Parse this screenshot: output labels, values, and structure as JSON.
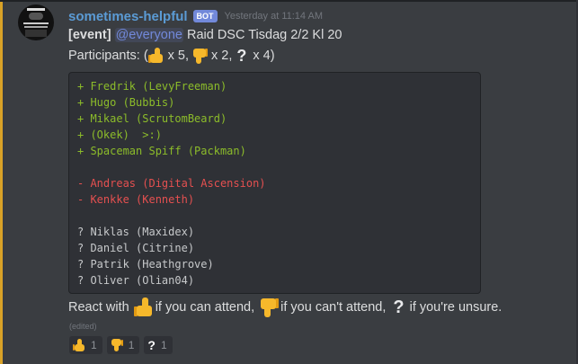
{
  "message": {
    "username": "sometimes-helpful",
    "bot_tag": "BOT",
    "timestamp": "Yesterday at 11:14 AM",
    "event_tag": "[event]",
    "mention": "@everyone",
    "event_title": "Raid DSC Tisdag 2/2 Kl 20",
    "participants_prefix": "Participants: (",
    "yes_count": "x 5,",
    "no_count": "x 2,",
    "maybe_count": "x 4)",
    "code_block": {
      "attending": [
        "+ Fredrik (LevyFreeman)",
        "+ Hugo (Bubbis)",
        "+ Mikael (ScrutomBeard)",
        "+ (Okek)  >:)",
        "+ Spaceman Spiff (Packman)"
      ],
      "not_attending": [
        "- Andreas (Digital Ascension)",
        "- Kenkke (Kenneth)"
      ],
      "unsure": [
        "? Niklas (Maxidex)",
        "? Daniel (Citrine)",
        "? Patrik (Heathgrove)",
        "? Oliver (Olian04)"
      ]
    },
    "react_prefix": "React with",
    "react_yes": "if you can attend,",
    "react_no": "if you can't attend,",
    "react_maybe": "if you're unsure.",
    "edited": "(edited)"
  },
  "reactions": [
    {
      "icon": "thumbs-up-icon",
      "count": "1"
    },
    {
      "icon": "thumbs-down-icon",
      "count": "1"
    },
    {
      "icon": "question-mark-icon",
      "glyph": "?",
      "count": "1"
    }
  ],
  "colors": {
    "accent": "#d9a227",
    "username": "#5b9bd5",
    "mention": "#7289da",
    "code_green": "#8cbc2a",
    "code_red": "#e55050"
  }
}
